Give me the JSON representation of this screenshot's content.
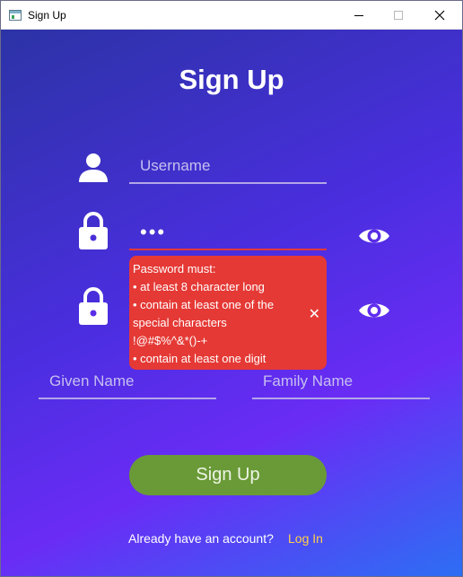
{
  "window": {
    "title": "Sign Up",
    "minimize_glyph": "",
    "close_glyph": "✕"
  },
  "form": {
    "heading": "Sign Up",
    "username_placeholder": "Username",
    "password_value": "•••",
    "confirm_password_value": "",
    "given_name_placeholder": "Given Name",
    "family_name_placeholder": "Family Name",
    "submit_label": "Sign Up"
  },
  "validation": {
    "lines": [
      "Password must:",
      "• at least 8 character long",
      "• contain at least one of the",
      "special characters",
      "!@#$%^&*()-+",
      "• contain at least one digit"
    ],
    "dismiss_glyph": "✕",
    "color": "#e53935"
  },
  "footer": {
    "prompt": "Already have an account?",
    "login_label": "Log In"
  },
  "icons": {
    "user": "user-icon",
    "lock": "lock-icon",
    "eye": "eye-icon"
  },
  "colors": {
    "accent_button": "#6a9a37",
    "link": "#ffcf4a",
    "error_underline": "#e03a3a"
  }
}
